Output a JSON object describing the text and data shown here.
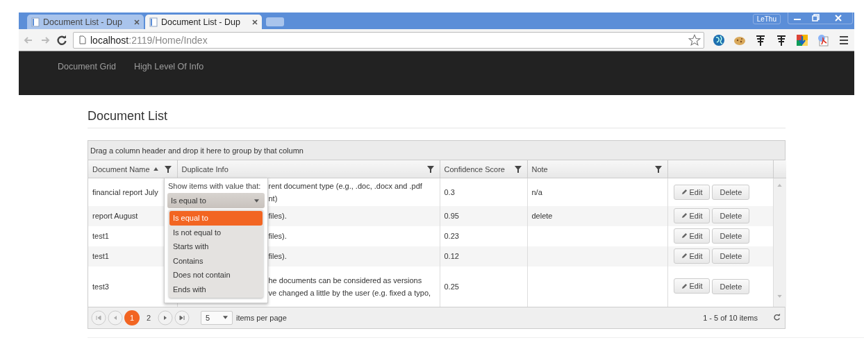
{
  "browser": {
    "tabs": [
      {
        "title": "Document List - Dup",
        "selected": false
      },
      {
        "title": "Document List - Dup",
        "selected": true
      }
    ],
    "address": {
      "host": "localhost",
      "path": ":2119/Home/Index"
    },
    "user": "LeThu"
  },
  "nav": {
    "items": [
      "Document Grid",
      "High Level Of Info"
    ]
  },
  "page_title": "Document List",
  "grid": {
    "group_hint": "Drag a column header and drop it here to group by that column",
    "columns": [
      {
        "label": "Document Name",
        "sorted": true,
        "filter": true
      },
      {
        "label": "Duplicate Info",
        "sorted": false,
        "filter": true
      },
      {
        "label": "Confidence Score",
        "sorted": false,
        "filter": true
      },
      {
        "label": "Note",
        "sorted": false,
        "filter": true
      }
    ],
    "rows": [
      {
        "name": "financial report July",
        "duplicate_info": [
          "rent document type (e.g., .doc, .docx and .pdf",
          "nt)"
        ],
        "score": "0.3",
        "note": "n/a",
        "edit": "Edit",
        "delete": "Delete"
      },
      {
        "name": "report August",
        "duplicate_info": [
          "files)."
        ],
        "score": "0.95",
        "note": "delete",
        "edit": "Edit",
        "delete": "Delete"
      },
      {
        "name": "test1",
        "duplicate_info": [
          "files)."
        ],
        "score": "0.23",
        "note": "",
        "edit": "Edit",
        "delete": "Delete"
      },
      {
        "name": "test1",
        "duplicate_info": [
          "files)."
        ],
        "score": "0.12",
        "note": "",
        "edit": "Edit",
        "delete": "Delete"
      },
      {
        "name": "test3",
        "duplicate_info": [
          "he documents can be considered as versions",
          "ve changed a little by the user (e.g. fixed a typo,"
        ],
        "score": "0.25",
        "note": "",
        "edit": "Edit",
        "delete": "Delete"
      }
    ],
    "filter_menu": {
      "label": "Show items with value that:",
      "value": "Is equal to",
      "options": [
        {
          "label": "Is equal to",
          "selected": true
        },
        {
          "label": "Is not equal to",
          "selected": false
        },
        {
          "label": "Starts with",
          "selected": false
        },
        {
          "label": "Contains",
          "selected": false
        },
        {
          "label": "Does not contain",
          "selected": false
        },
        {
          "label": "Ends with",
          "selected": false
        }
      ]
    }
  },
  "pager": {
    "pages": [
      {
        "label": "1",
        "selected": true
      },
      {
        "label": "2",
        "selected": false
      }
    ],
    "page_size": "5",
    "page_size_label": "items per page",
    "info": "1 - 5 of 10 items"
  }
}
